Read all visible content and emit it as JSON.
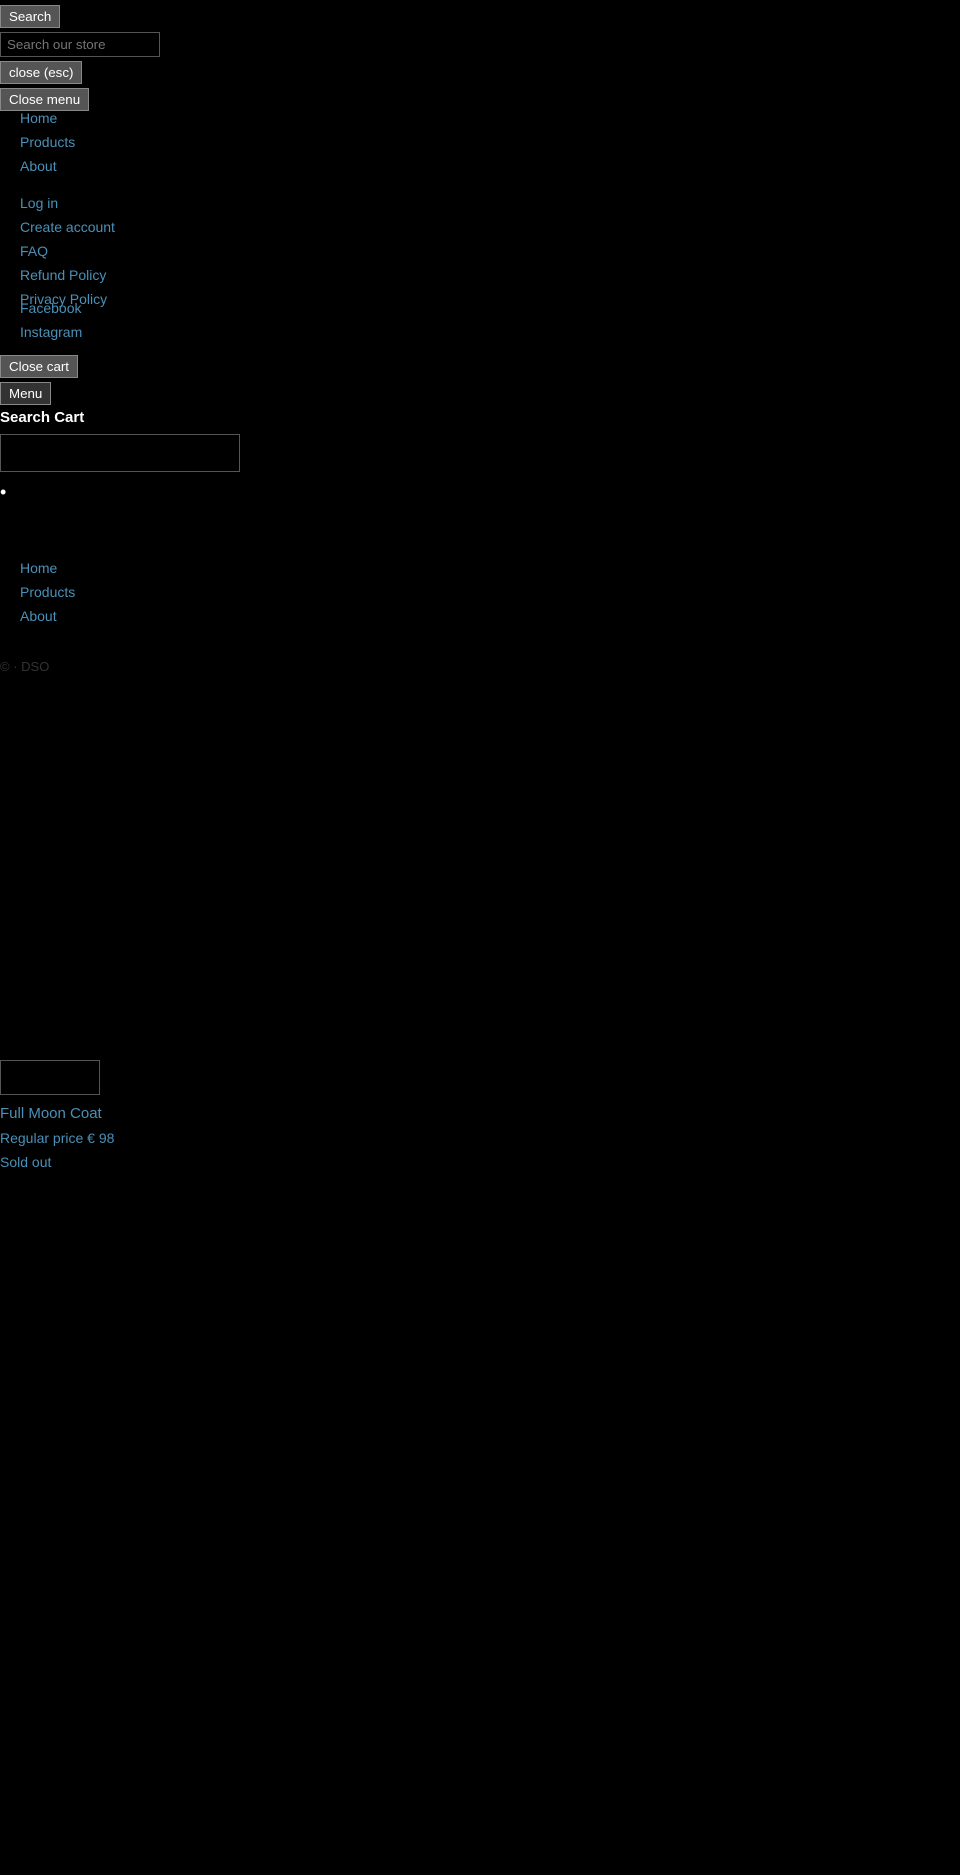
{
  "search": {
    "button_label": "Search",
    "placeholder": "Search our store",
    "close_esc_label": "close (esc)",
    "close_menu_label": "Close menu"
  },
  "nav": {
    "items": [
      {
        "label": "Home",
        "href": "#"
      },
      {
        "label": "Products",
        "href": "#"
      },
      {
        "label": "About",
        "href": "#"
      }
    ]
  },
  "account": {
    "items": [
      {
        "label": "Log in",
        "href": "#"
      },
      {
        "label": "Create account",
        "href": "#"
      },
      {
        "label": "FAQ",
        "href": "#"
      },
      {
        "label": "Refund Policy",
        "href": "#"
      },
      {
        "label": "Privacy Policy",
        "href": "#"
      }
    ]
  },
  "social": {
    "items": [
      {
        "label": "Facebook",
        "href": "#"
      },
      {
        "label": "Instagram",
        "href": "#"
      }
    ]
  },
  "cart": {
    "close_cart_label": "Close cart",
    "menu_label": "Menu",
    "search_cart_label": "Search Cart",
    "search_placeholder": ""
  },
  "footer_nav": {
    "items": [
      {
        "label": "Home",
        "href": "#"
      },
      {
        "label": "Products",
        "href": "#"
      },
      {
        "label": "About",
        "href": "#"
      }
    ]
  },
  "copyright": {
    "text": "© · DSO"
  },
  "product": {
    "title": "Full Moon Coat",
    "price_label": "Regular price € 98",
    "sold_out_label": "Sold out"
  }
}
